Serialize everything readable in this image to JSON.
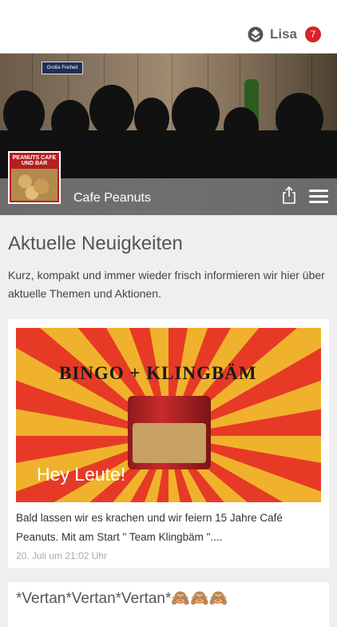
{
  "header": {
    "username": "Lisa",
    "notification_count": "7",
    "logo_icon": "stack-logo-icon"
  },
  "hero": {
    "street_sign": "Große Freiheit",
    "cafe_name": "Cafe Peanuts",
    "thumb_label": "PEANUTS CAFE UND BAR",
    "share_icon": "share-icon",
    "menu_icon": "hamburger-menu-icon"
  },
  "main": {
    "heading": "Aktuelle Neuigkeiten",
    "intro": "Kurz, kompakt und immer wieder frisch informieren wir hier über aktuelle Themen und Aktionen."
  },
  "news": [
    {
      "image_title": "BINGO + KLINGBÄM",
      "overlay": "Hey Leute!",
      "text": "Bald lassen wir es krachen und wir feiern 15 Jahre Café Peanuts. Mit am Start \" Team Klingbäm \"....",
      "date": "20. Juli um 21:02 Uhr"
    },
    {
      "title": "*Vertan*Vertan*Vertan*🙈🙈🙈"
    }
  ],
  "colors": {
    "badge": "#d9232a",
    "titlebar": "#6e6e6e",
    "background": "#efefef"
  }
}
